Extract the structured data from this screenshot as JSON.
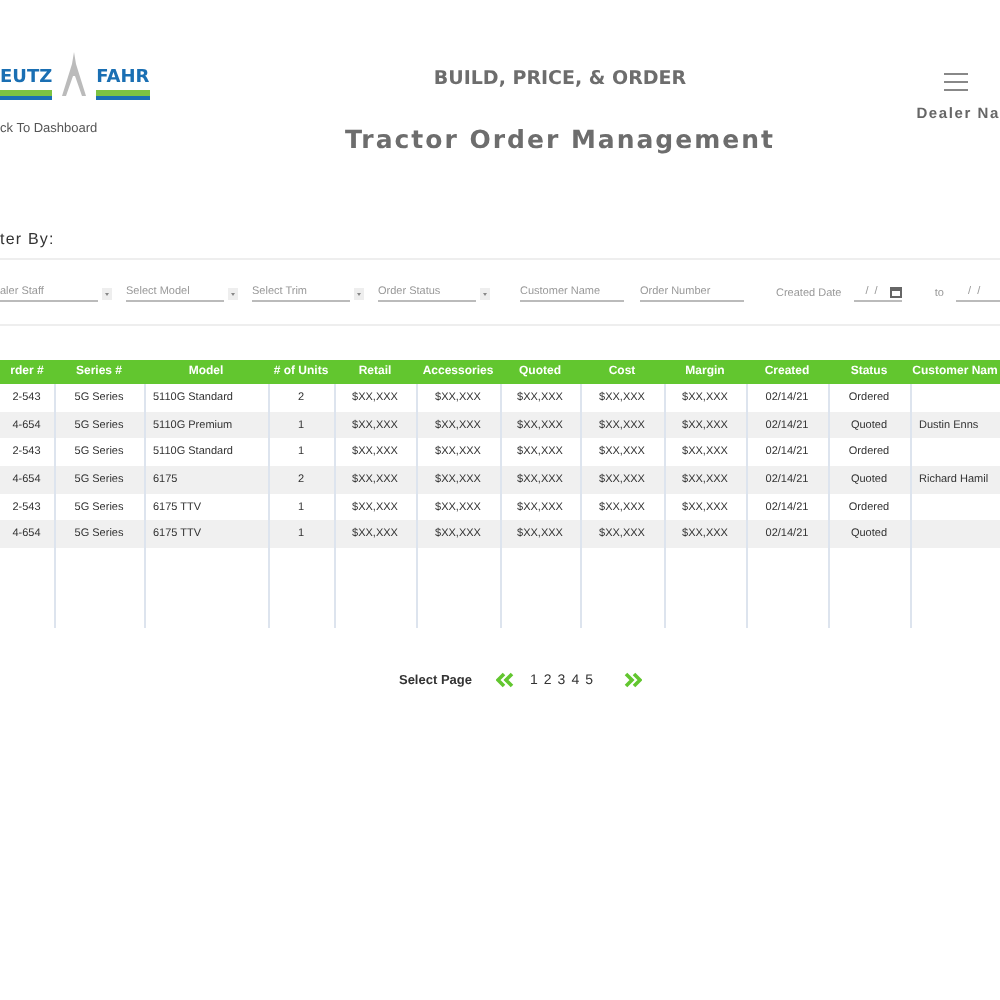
{
  "header": {
    "logo": {
      "left_text": "EUTZ",
      "right_text": "FAHR"
    },
    "app_title": "BUILD, PRICE, & ORDER",
    "user": "Dealer Na",
    "back_link": "ck To Dashboard",
    "page_title": "Tractor Order Management"
  },
  "filter_label": "ter By:",
  "filters": [
    {
      "kind": "select",
      "placeholder": "aler Staff"
    },
    {
      "kind": "select",
      "placeholder": "Select Model"
    },
    {
      "kind": "select",
      "placeholder": "Select Trim"
    },
    {
      "kind": "select",
      "placeholder": "Order Status"
    },
    {
      "kind": "text",
      "placeholder": "Customer Name"
    },
    {
      "kind": "text",
      "placeholder": "Order Number"
    },
    {
      "kind": "date",
      "label": "Created Date",
      "value": "/  /"
    },
    {
      "kind": "date_cut",
      "label": "to",
      "value": "/  /"
    }
  ],
  "table": {
    "columns": [
      "rder #",
      "Series #",
      "Model",
      "# of Units",
      "Retail",
      "Accessories",
      "Quoted",
      "Cost",
      "Margin",
      "Created",
      "Status",
      "Customer Nam"
    ],
    "rows": [
      [
        "2-543",
        "5G Series",
        "5110G Standard",
        "2",
        "$XX,XXX",
        "$XX,XXX",
        "$XX,XXX",
        "$XX,XXX",
        "$XX,XXX",
        "02/14/21",
        "Ordered",
        ""
      ],
      [
        "4-654",
        "5G Series",
        "5110G Premium",
        "1",
        "$XX,XXX",
        "$XX,XXX",
        "$XX,XXX",
        "$XX,XXX",
        "$XX,XXX",
        "02/14/21",
        "Quoted",
        "Dustin Enns"
      ],
      [
        "2-543",
        "5G Series",
        "5110G Standard",
        "1",
        "$XX,XXX",
        "$XX,XXX",
        "$XX,XXX",
        "$XX,XXX",
        "$XX,XXX",
        "02/14/21",
        "Ordered",
        ""
      ],
      [
        "4-654",
        "5G Series",
        "6175",
        "2",
        "$XX,XXX",
        "$XX,XXX",
        "$XX,XXX",
        "$XX,XXX",
        "$XX,XXX",
        "02/14/21",
        "Quoted",
        "Richard Hamil"
      ],
      [
        "2-543",
        "5G Series",
        "6175 TTV",
        "1",
        "$XX,XXX",
        "$XX,XXX",
        "$XX,XXX",
        "$XX,XXX",
        "$XX,XXX",
        "02/14/21",
        "Ordered",
        ""
      ],
      [
        "4-654",
        "5G Series",
        "6175 TTV",
        "1",
        "$XX,XXX",
        "$XX,XXX",
        "$XX,XXX",
        "$XX,XXX",
        "$XX,XXX",
        "02/14/21",
        "Quoted",
        ""
      ]
    ]
  },
  "pagination": {
    "label": "Select Page",
    "pages": [
      "1",
      "2",
      "3",
      "4",
      "5"
    ]
  }
}
